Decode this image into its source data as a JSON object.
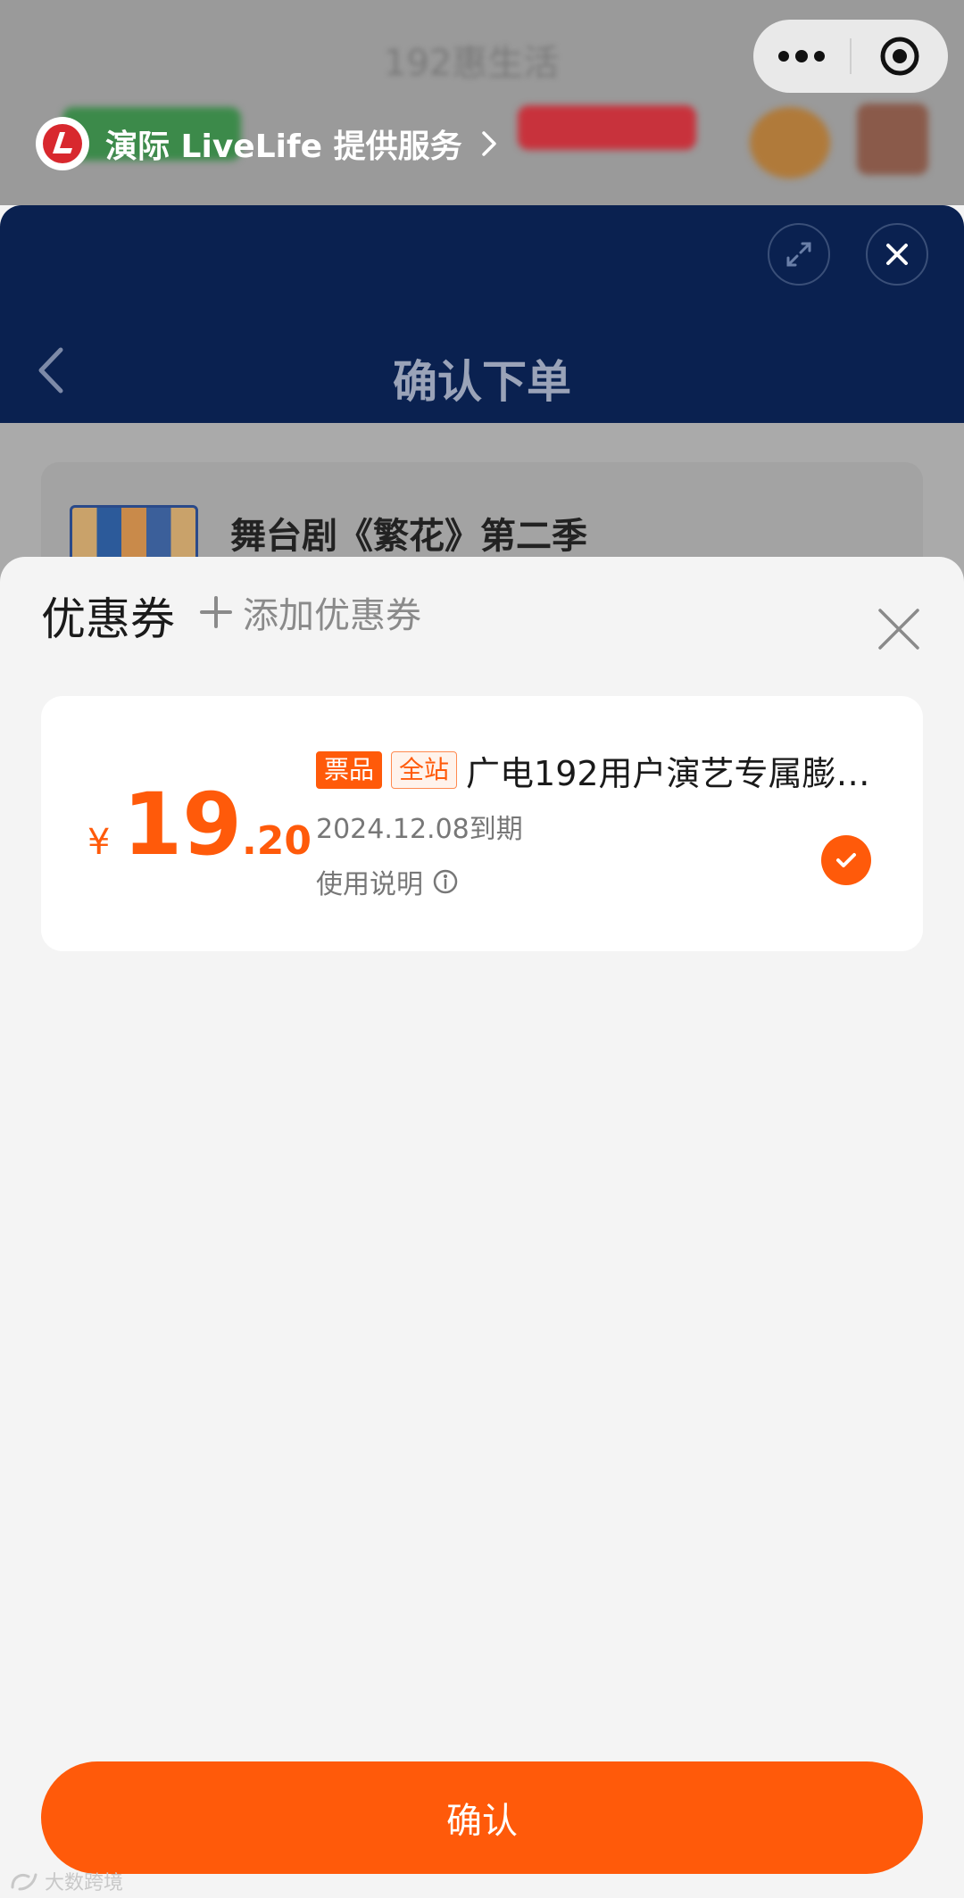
{
  "background": {
    "provider_label": "演际 LiveLife 提供服务",
    "order_title": "确认下单",
    "show_title": "舞台剧《繁花》第二季"
  },
  "coupon_sheet": {
    "title": "优惠券",
    "add_coupon_label": "添加优惠券",
    "coupon": {
      "currency": "¥",
      "amount_integer": "19",
      "amount_decimal": ".20",
      "tags": [
        "票品",
        "全站"
      ],
      "name": "广电192用户演艺专属膨…",
      "expiry": "2024.12.08到期",
      "usage_label": "使用说明",
      "selected": true
    },
    "confirm_label": "确认"
  },
  "watermark": "大数跨境",
  "colors": {
    "accent": "#ff5a0a",
    "navy": "#0a2150",
    "sheet_bg": "#f4f4f4"
  }
}
